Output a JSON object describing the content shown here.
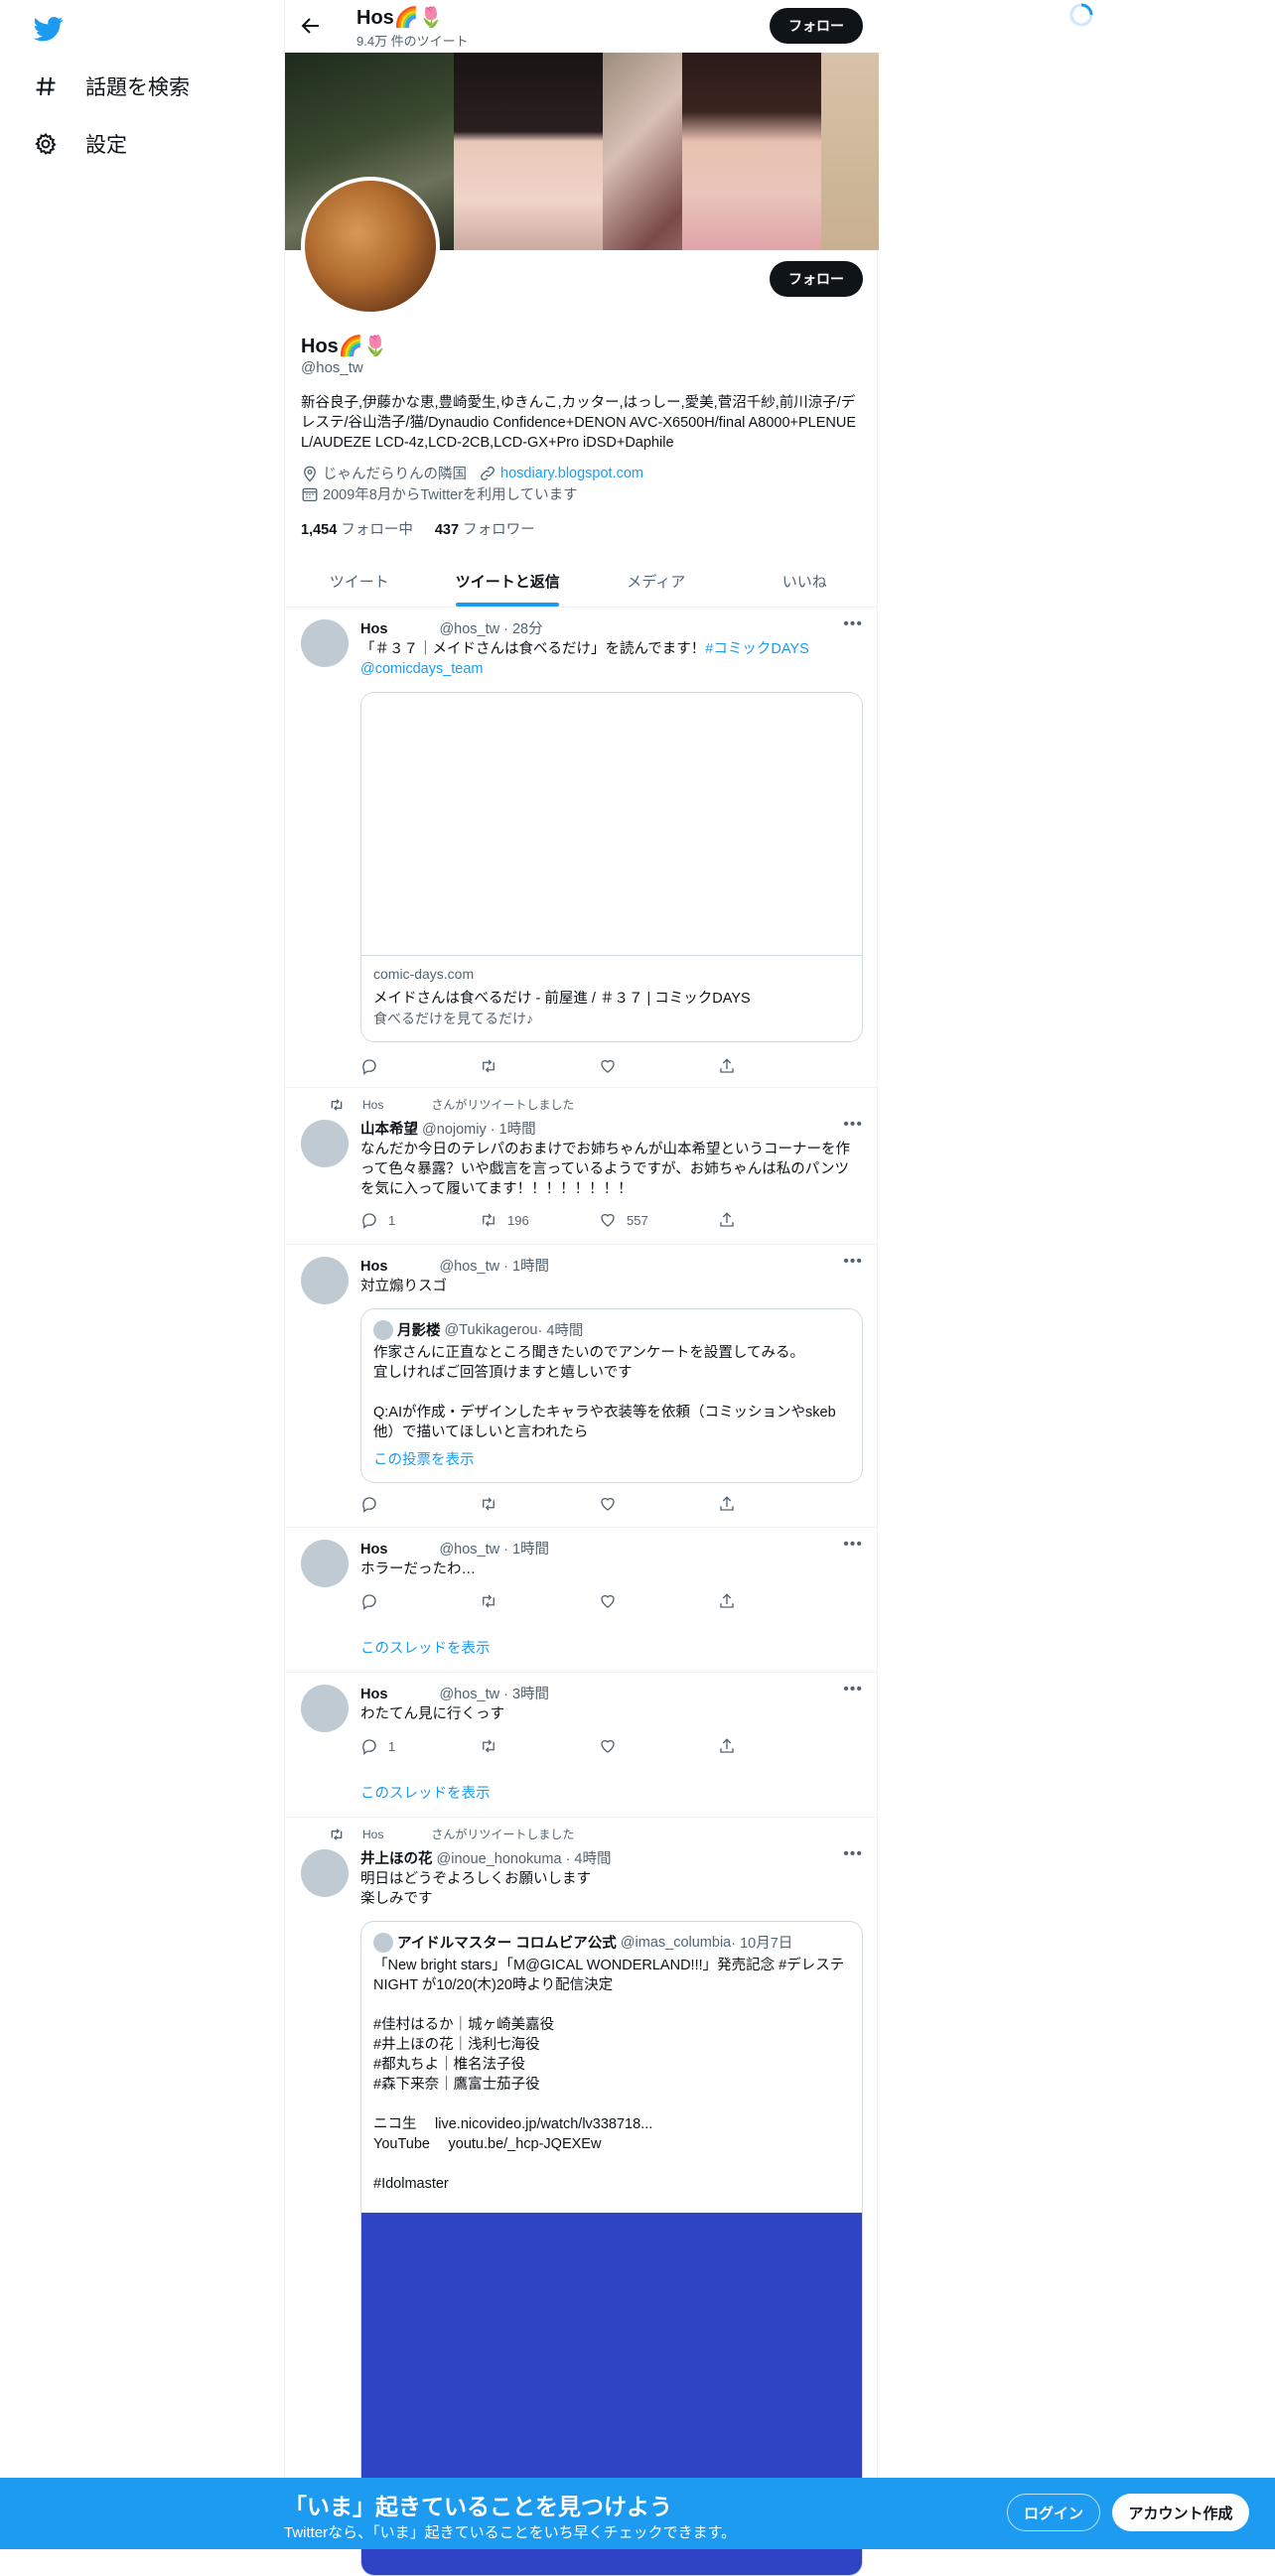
{
  "nav": {
    "explore_label": "話題を検索",
    "settings_label": "設定"
  },
  "header": {
    "title": "Hos🌈🌷",
    "subtitle": "9.4万 件のツイート",
    "follow_label": "フォロー"
  },
  "profile": {
    "name": "Hos🌈🌷",
    "handle": "@hos_tw",
    "follow_label": "フォロー",
    "bio": "新谷良子,伊藤かな恵,豊崎愛生,ゆきんこ,カッター,はっしー,愛美,菅沼千紗,前川涼子/デレステ/谷山浩子/猫/Dynaudio Confidence+DENON AVC-X6500H/final A8000+PLENUE L/AUDEZE LCD-4z,LCD-2CB,LCD-GX+Pro iDSD+Daphile",
    "location": "じゃんだらりんの隣国",
    "website": "hosdiary.blogspot.com",
    "joined": "2009年8月からTwitterを利用しています",
    "following_count": "1,454",
    "following_label": "フォロー中",
    "followers_count": "437",
    "followers_label": "フォロワー"
  },
  "tabs": [
    {
      "label": "ツイート"
    },
    {
      "label": "ツイートと返信"
    },
    {
      "label": "メディア"
    },
    {
      "label": "いいね"
    }
  ],
  "tweets": [
    {
      "name": "Hos",
      "handle": "@hos_tw",
      "time": "· 28分",
      "text_plain": "「＃３７｜メイドさんは食べるだけ」を読んでます！",
      "hashtag": "#コミックDAYS",
      "mention": "@comicdays_team",
      "card_domain": "comic-days.com",
      "card_title": "メイドさんは食べるだけ - 前屋進 / ＃３７ | コミックDAYS",
      "card_desc": "食べるだけを見てるだけ♪"
    },
    {
      "retweeted_by": "Hos",
      "retweet_label": "さんがリツイートしました",
      "name": "山本希望",
      "handle": "@nojomiy",
      "time": "· 1時間",
      "text": "なんだか今日のテレパのおまけでお姉ちゃんが山本希望というコーナーを作って色々暴露？いや戯言を言っているようですが、お姉ちゃんは私のパンツを気に入って履いてます！！！！！！！！",
      "replies": "1",
      "retweets": "196",
      "likes": "557"
    },
    {
      "name": "Hos",
      "handle": "@hos_tw",
      "time": "· 1時間",
      "text": "対立煽りスゴ",
      "quote_name": "月影楼",
      "quote_handle": "@Tukikagerou",
      "quote_time": "· 4時間",
      "quote_text": "作家さんに正直なところ聞きたいのでアンケートを設置してみる。\n宜しければご回答頂けますと嬉しいです\n\nQ:AIが作成・デザインしたキャラや衣装等を依頼（コミッションやskeb他）で描いてほしいと言われたら",
      "quote_link": "この投票を表示"
    },
    {
      "name": "Hos",
      "handle": "@hos_tw",
      "time": "· 1時間",
      "text": "ホラーだったわ…",
      "thread_link": "このスレッドを表示"
    },
    {
      "name": "Hos",
      "handle": "@hos_tw",
      "time": "· 3時間",
      "text": "わたてん見に行くっす",
      "replies": "1",
      "thread_link": "このスレッドを表示"
    },
    {
      "retweeted_by": "Hos",
      "retweet_label": "さんがリツイートしました",
      "name": "井上ほの花",
      "handle": "@inoue_honokuma",
      "time": "· 4時間",
      "text": "明日はどうぞよろしくお願いします\n楽しみです",
      "quote_name": "アイドルマスター コロムビア公式",
      "quote_handle": "@imas_columbia",
      "quote_time": "· 10月7日",
      "quote_text": "「New bright stars」「M@GICAL WONDERLAND!!!」発売記念 #デレステNIGHT が10/20(木)20時より配信決定\n\n#佳村はるか｜城ヶ崎美嘉役\n#井上ほの花｜浅利七海役\n#都丸ちよ｜椎名法子役\n#森下来奈｜鷹富士茄子役\n\nニコ生　 live.nicovideo.jp/watch/lv338718...\nYouTube　 youtu.be/_hcp-JQEXEw\n\n#Idolmaster"
    }
  ],
  "bottom_bar": {
    "title": "「いま」起きていることを見つけよう",
    "subtitle": "Twitterなら、「いま」起きていることをいち早くチェックできます。",
    "login_label": "ログイン",
    "signup_label": "アカウント作成"
  },
  "colors": {
    "accent": "#1d9bf0",
    "text": "#0f1419",
    "muted": "#536471",
    "border": "#eff3f4",
    "dark_button": "#0f1419",
    "quote_media": "#2f44c4"
  }
}
